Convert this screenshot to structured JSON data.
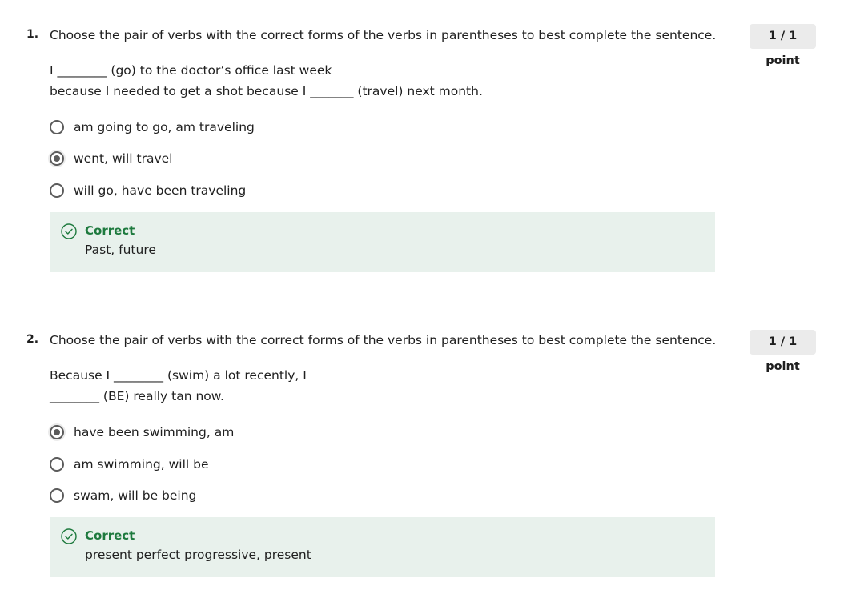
{
  "questions": [
    {
      "number": "1.",
      "prompt": "Choose the pair of verbs with the correct forms of the verbs in parentheses to best complete the sentence.",
      "points": "1 / 1 point",
      "sentence_lines": [
        "I ________ (go) to the doctor’s office last week",
        "because I needed to get a shot because I _______ (travel) next month."
      ],
      "options": [
        {
          "label": "am going to go, am traveling",
          "selected": false
        },
        {
          "label": "went, will travel",
          "selected": true
        },
        {
          "label": "will go, have been traveling",
          "selected": false
        }
      ],
      "feedback": {
        "status": "Correct",
        "explanation": "Past, future",
        "icon": "check-circle-icon"
      }
    },
    {
      "number": "2.",
      "prompt": "Choose the pair of verbs with the correct forms of the verbs in parentheses to best complete the sentence.",
      "points": "1 / 1 point",
      "sentence_lines": [
        "Because I ________ (swim) a lot recently, I",
        "________ (BE) really tan now."
      ],
      "options": [
        {
          "label": "have been swimming, am",
          "selected": true
        },
        {
          "label": "am swimming, will be",
          "selected": false
        },
        {
          "label": "swam, will be being",
          "selected": false
        }
      ],
      "feedback": {
        "status": "Correct",
        "explanation": "present perfect progressive, present",
        "icon": "check-circle-icon"
      }
    }
  ],
  "colors": {
    "feedback_bg": "#e8f1ec",
    "correct_green": "#1e7a3e",
    "badge_bg": "#ebebeb",
    "radio_border": "#5b5b5b"
  }
}
